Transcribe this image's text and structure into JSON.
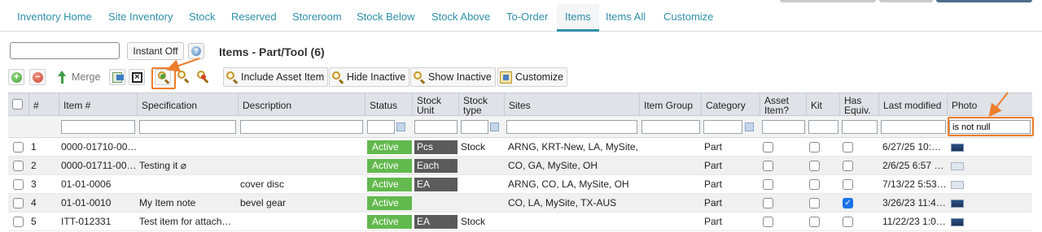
{
  "tabs": [
    {
      "label": "Inventory Home"
    },
    {
      "label": "Site Inventory"
    },
    {
      "label": "Stock"
    },
    {
      "label": "Reserved"
    },
    {
      "label": "Storeroom"
    },
    {
      "label": "Stock Below"
    },
    {
      "label": "Stock Above"
    },
    {
      "label": "To-Order"
    },
    {
      "label": "Items",
      "active": true
    },
    {
      "label": "Items All"
    },
    {
      "label": "Customize"
    }
  ],
  "title_row": {
    "search_value": "",
    "instant_label": "Instant Off",
    "page_title": "Items - Part/Tool (6)"
  },
  "toolbar": {
    "merge_label": "Merge",
    "include_asset_label": "Include Asset Item",
    "hide_inactive_label": "Hide Inactive",
    "show_inactive_label": "Show Inactive",
    "customize_label": "Customize"
  },
  "columns": {
    "num": "#",
    "item_num": "Item #",
    "specification": "Specification",
    "description": "Description",
    "status": "Status",
    "stock_unit": "Stock Unit",
    "stock_type": "Stock type",
    "sites": "Sites",
    "item_group": "Item Group",
    "category": "Category",
    "asset_item": "Asset Item?",
    "kit": "Kit",
    "has_equiv": "Has Equiv.",
    "last_modified": "Last modified",
    "photo": "Photo"
  },
  "filters": {
    "photo": "is not null"
  },
  "rows": [
    {
      "num": "1",
      "item": "0000-01710-00…",
      "spec": "",
      "desc": "",
      "status": "Active",
      "unit": "Pcs",
      "type": "Stock",
      "sites": "ARNG, KRT-New, LA, MySite,…",
      "group": "",
      "category": "Part",
      "asset": false,
      "kit": false,
      "equiv": false,
      "modified": "6/27/25 10:…",
      "photo": "dark"
    },
    {
      "num": "2",
      "item": "0000-01711-00…",
      "spec": "Testing it ⌀",
      "desc": "",
      "status": "Active",
      "unit": "Each",
      "type": "",
      "sites": "CO, GA, MySite, OH",
      "group": "",
      "category": "Part",
      "asset": false,
      "kit": false,
      "equiv": false,
      "modified": "2/6/25 6:57 …",
      "photo": "light"
    },
    {
      "num": "3",
      "item": "01-01-0006",
      "spec": "",
      "desc": "cover disc",
      "status": "Active",
      "unit": "EA",
      "type": "",
      "sites": "ARNG, CO, LA, MySite, OH",
      "group": "",
      "category": "Part",
      "asset": false,
      "kit": false,
      "equiv": false,
      "modified": "7/13/22 5:53…",
      "photo": "light"
    },
    {
      "num": "4",
      "item": "01-01-0010",
      "spec": "My Item note",
      "desc": "bevel gear",
      "status": "Active",
      "unit": "",
      "type": "",
      "sites": "CO, LA, MySite, TX-AUS",
      "group": "",
      "category": "Part",
      "asset": false,
      "kit": false,
      "equiv": true,
      "modified": "3/26/23 11:4…",
      "photo": "dark"
    },
    {
      "num": "5",
      "item": "ITT-012331",
      "spec": "Test item for attach…",
      "desc": "",
      "status": "Active",
      "unit": "EA",
      "type": "Stock",
      "sites": "",
      "group": "",
      "category": "Part",
      "asset": false,
      "kit": false,
      "equiv": false,
      "modified": "11/22/23 1:0…",
      "photo": "dark"
    }
  ],
  "colors": {
    "accent": "#2f8fa8",
    "active_status": "#62b94e",
    "unit_badge": "#5b5b5b",
    "annotation": "#ee7d2c",
    "checked": "#1a73e8"
  },
  "icons": [
    "help-icon",
    "add-icon",
    "remove-icon",
    "merge-icon",
    "export-icon",
    "clear-icon",
    "search-icon",
    "search-clear-icon",
    "search-remove-icon",
    "photo-icon"
  ]
}
